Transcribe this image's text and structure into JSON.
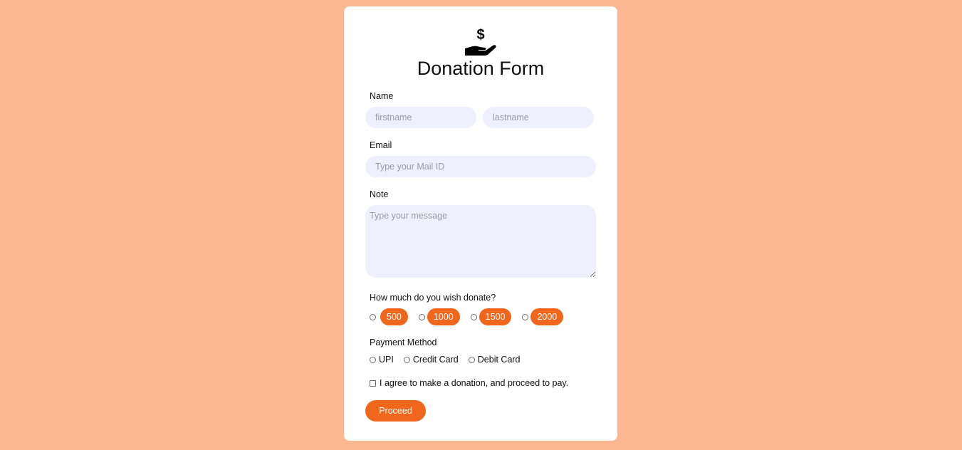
{
  "form": {
    "icon": "donation-hand-icon",
    "title": "Donation Form",
    "name_label": "Name",
    "firstname_placeholder": "firstname",
    "lastname_placeholder": "lastname",
    "email_label": "Email",
    "email_placeholder": "Type your Mail ID",
    "note_label": "Note",
    "note_placeholder": "Type your message",
    "amount_question": "How much do you wish donate?",
    "amounts": [
      "500",
      "1000",
      "1500",
      "2000"
    ],
    "payment_label": "Payment Method",
    "payment_methods": [
      "UPI",
      "Credit Card",
      "Debit Card"
    ],
    "agree_text": "I agree to make a donation, and proceed to pay.",
    "proceed_label": "Proceed"
  },
  "colors": {
    "background": "#fdb891",
    "accent": "#f0661d",
    "input_bg": "#eef0fd"
  }
}
